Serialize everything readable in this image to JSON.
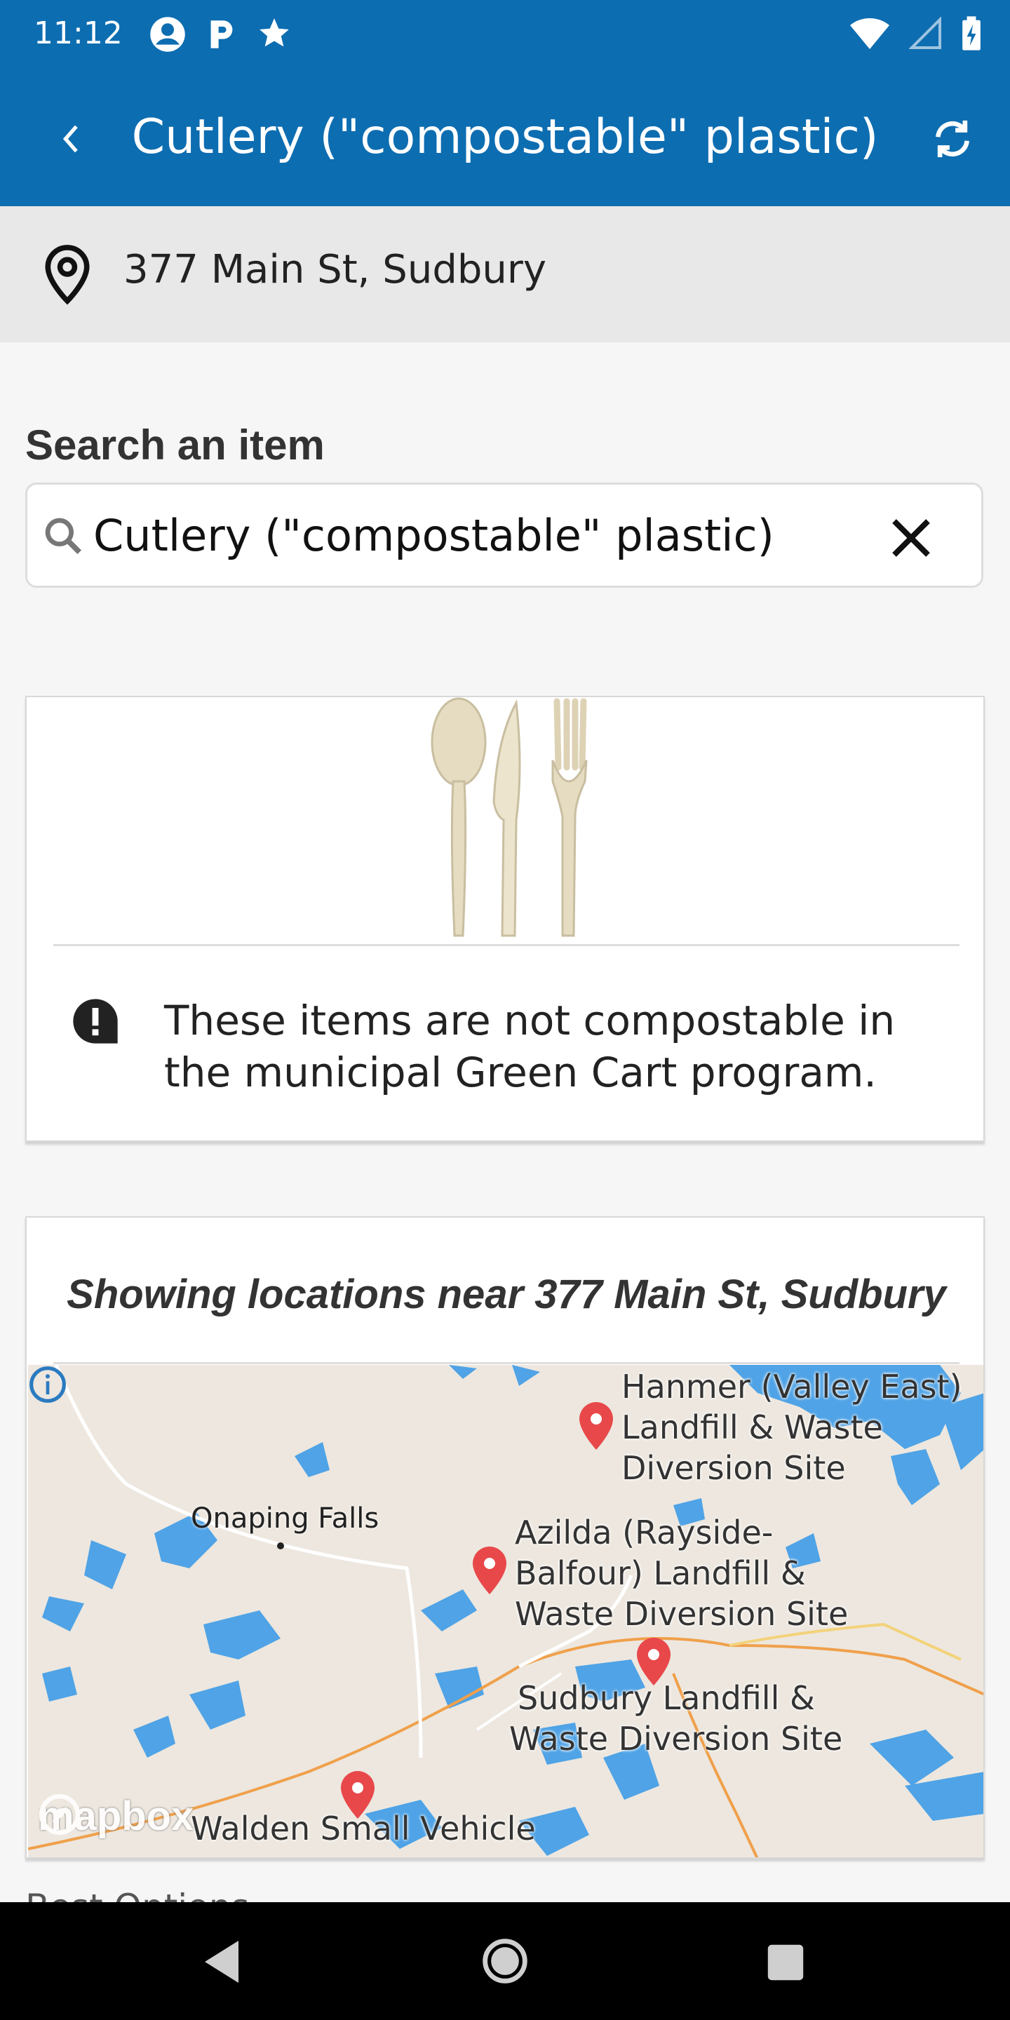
{
  "status_bar": {
    "time": "11:12",
    "left_icons": [
      "account-circle-icon",
      "parking-icon",
      "star-icon"
    ],
    "right_icons": [
      "wifi-icon",
      "signal-icon",
      "battery-charging-icon"
    ]
  },
  "app_bar": {
    "title": "Cutlery (\"compostable\" plastic)",
    "back_icon": "chevron-left-icon",
    "refresh_icon": "refresh-icon"
  },
  "address": {
    "text": "377 Main St, Sudbury",
    "icon": "location-pin-icon"
  },
  "search": {
    "label": "Search an item",
    "value": "Cutlery (\"compostable\" plastic)",
    "clear_icon": "close-icon"
  },
  "item_card": {
    "image": "compostable-cutlery-image",
    "alert_icon": "exclamation-bubble-icon",
    "message": "These items are not compostable in the municipal Green Cart program."
  },
  "map_card": {
    "title": "Showing locations near 377 Main St, Sudbury",
    "town": "Onaping Falls",
    "locations": [
      {
        "name_lines": [
          "Hanmer (Valley East)",
          "Landfill & Waste",
          "Diversion Site"
        ]
      },
      {
        "name_lines": [
          "Azilda (Rayside-",
          "Balfour) Landfill &",
          "Waste Diversion Site"
        ]
      },
      {
        "name_lines": [
          "Sudbury Landfill &",
          "Waste Diversion Site"
        ]
      },
      {
        "name_lines": [
          "Walden Small Vehicle"
        ]
      }
    ],
    "attribution": "mapbox",
    "colors": {
      "land": "#ede7df",
      "water": "#4fa3e6",
      "road": "#f0a04b",
      "marker": "#e8484a"
    }
  },
  "peek_text": "Best Options",
  "nav_bar": {
    "icons": [
      "back-triangle-icon",
      "home-circle-icon",
      "recents-square-icon"
    ]
  }
}
